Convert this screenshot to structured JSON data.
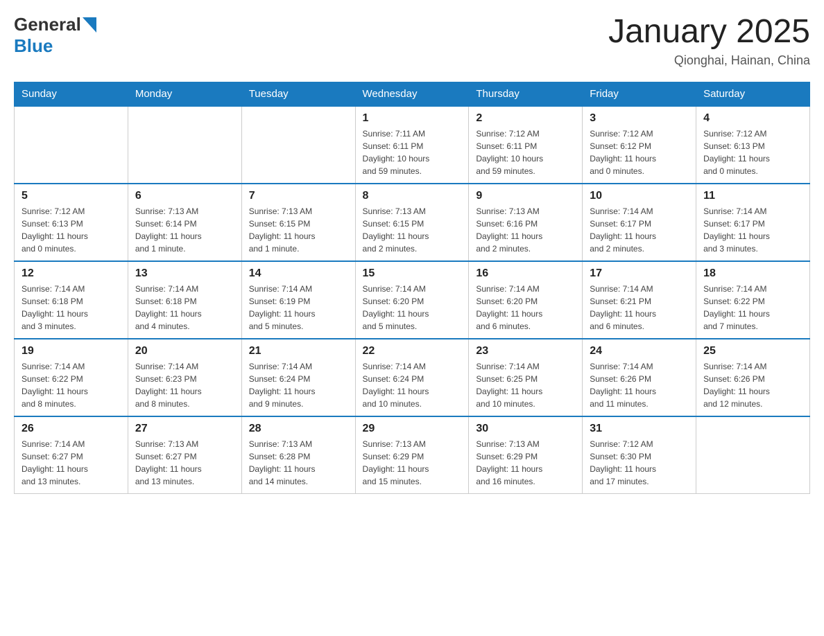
{
  "header": {
    "logo_general": "General",
    "logo_blue": "Blue",
    "month_title": "January 2025",
    "location": "Qionghai, Hainan, China"
  },
  "weekdays": [
    "Sunday",
    "Monday",
    "Tuesday",
    "Wednesday",
    "Thursday",
    "Friday",
    "Saturday"
  ],
  "weeks": [
    [
      {
        "day": "",
        "info": ""
      },
      {
        "day": "",
        "info": ""
      },
      {
        "day": "",
        "info": ""
      },
      {
        "day": "1",
        "info": "Sunrise: 7:11 AM\nSunset: 6:11 PM\nDaylight: 10 hours\nand 59 minutes."
      },
      {
        "day": "2",
        "info": "Sunrise: 7:12 AM\nSunset: 6:11 PM\nDaylight: 10 hours\nand 59 minutes."
      },
      {
        "day": "3",
        "info": "Sunrise: 7:12 AM\nSunset: 6:12 PM\nDaylight: 11 hours\nand 0 minutes."
      },
      {
        "day": "4",
        "info": "Sunrise: 7:12 AM\nSunset: 6:13 PM\nDaylight: 11 hours\nand 0 minutes."
      }
    ],
    [
      {
        "day": "5",
        "info": "Sunrise: 7:12 AM\nSunset: 6:13 PM\nDaylight: 11 hours\nand 0 minutes."
      },
      {
        "day": "6",
        "info": "Sunrise: 7:13 AM\nSunset: 6:14 PM\nDaylight: 11 hours\nand 1 minute."
      },
      {
        "day": "7",
        "info": "Sunrise: 7:13 AM\nSunset: 6:15 PM\nDaylight: 11 hours\nand 1 minute."
      },
      {
        "day": "8",
        "info": "Sunrise: 7:13 AM\nSunset: 6:15 PM\nDaylight: 11 hours\nand 2 minutes."
      },
      {
        "day": "9",
        "info": "Sunrise: 7:13 AM\nSunset: 6:16 PM\nDaylight: 11 hours\nand 2 minutes."
      },
      {
        "day": "10",
        "info": "Sunrise: 7:14 AM\nSunset: 6:17 PM\nDaylight: 11 hours\nand 2 minutes."
      },
      {
        "day": "11",
        "info": "Sunrise: 7:14 AM\nSunset: 6:17 PM\nDaylight: 11 hours\nand 3 minutes."
      }
    ],
    [
      {
        "day": "12",
        "info": "Sunrise: 7:14 AM\nSunset: 6:18 PM\nDaylight: 11 hours\nand 3 minutes."
      },
      {
        "day": "13",
        "info": "Sunrise: 7:14 AM\nSunset: 6:18 PM\nDaylight: 11 hours\nand 4 minutes."
      },
      {
        "day": "14",
        "info": "Sunrise: 7:14 AM\nSunset: 6:19 PM\nDaylight: 11 hours\nand 5 minutes."
      },
      {
        "day": "15",
        "info": "Sunrise: 7:14 AM\nSunset: 6:20 PM\nDaylight: 11 hours\nand 5 minutes."
      },
      {
        "day": "16",
        "info": "Sunrise: 7:14 AM\nSunset: 6:20 PM\nDaylight: 11 hours\nand 6 minutes."
      },
      {
        "day": "17",
        "info": "Sunrise: 7:14 AM\nSunset: 6:21 PM\nDaylight: 11 hours\nand 6 minutes."
      },
      {
        "day": "18",
        "info": "Sunrise: 7:14 AM\nSunset: 6:22 PM\nDaylight: 11 hours\nand 7 minutes."
      }
    ],
    [
      {
        "day": "19",
        "info": "Sunrise: 7:14 AM\nSunset: 6:22 PM\nDaylight: 11 hours\nand 8 minutes."
      },
      {
        "day": "20",
        "info": "Sunrise: 7:14 AM\nSunset: 6:23 PM\nDaylight: 11 hours\nand 8 minutes."
      },
      {
        "day": "21",
        "info": "Sunrise: 7:14 AM\nSunset: 6:24 PM\nDaylight: 11 hours\nand 9 minutes."
      },
      {
        "day": "22",
        "info": "Sunrise: 7:14 AM\nSunset: 6:24 PM\nDaylight: 11 hours\nand 10 minutes."
      },
      {
        "day": "23",
        "info": "Sunrise: 7:14 AM\nSunset: 6:25 PM\nDaylight: 11 hours\nand 10 minutes."
      },
      {
        "day": "24",
        "info": "Sunrise: 7:14 AM\nSunset: 6:26 PM\nDaylight: 11 hours\nand 11 minutes."
      },
      {
        "day": "25",
        "info": "Sunrise: 7:14 AM\nSunset: 6:26 PM\nDaylight: 11 hours\nand 12 minutes."
      }
    ],
    [
      {
        "day": "26",
        "info": "Sunrise: 7:14 AM\nSunset: 6:27 PM\nDaylight: 11 hours\nand 13 minutes."
      },
      {
        "day": "27",
        "info": "Sunrise: 7:13 AM\nSunset: 6:27 PM\nDaylight: 11 hours\nand 13 minutes."
      },
      {
        "day": "28",
        "info": "Sunrise: 7:13 AM\nSunset: 6:28 PM\nDaylight: 11 hours\nand 14 minutes."
      },
      {
        "day": "29",
        "info": "Sunrise: 7:13 AM\nSunset: 6:29 PM\nDaylight: 11 hours\nand 15 minutes."
      },
      {
        "day": "30",
        "info": "Sunrise: 7:13 AM\nSunset: 6:29 PM\nDaylight: 11 hours\nand 16 minutes."
      },
      {
        "day": "31",
        "info": "Sunrise: 7:12 AM\nSunset: 6:30 PM\nDaylight: 11 hours\nand 17 minutes."
      },
      {
        "day": "",
        "info": ""
      }
    ]
  ]
}
